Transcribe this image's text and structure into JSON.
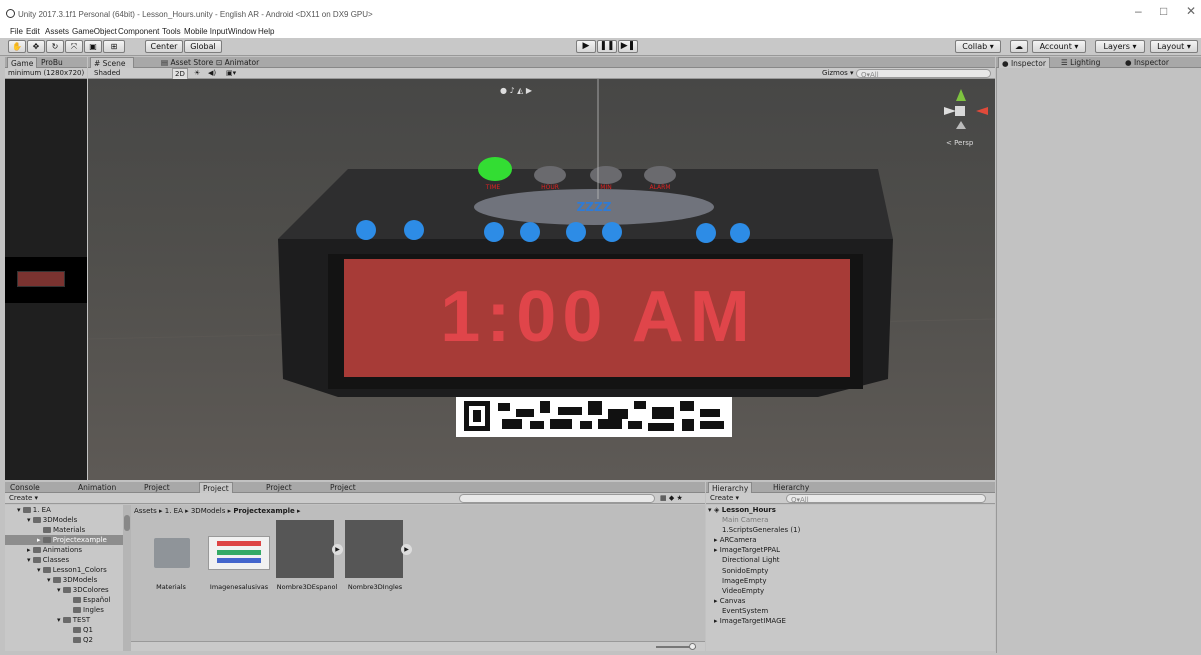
{
  "window": {
    "title": "Unity 2017.3.1f1 Personal (64bit) - Lesson_Hours.unity - English AR - Android <DX11 on DX9 GPU>",
    "controls": [
      "–",
      "□",
      "✕"
    ]
  },
  "menu": [
    "File",
    "Edit",
    "Assets",
    "GameObject",
    "Component",
    "Tools",
    "Mobile Input",
    "Window",
    "Help"
  ],
  "toolbar": {
    "center": "Center",
    "global": "Global",
    "collab": "Collab ▾",
    "account": "Account ▾",
    "layers": "Layers ▾",
    "layout": "Layout ▾"
  },
  "top_tabs": {
    "game": "Game",
    "probuilder": "ProBu",
    "scene": "# Scene",
    "asset_store": "Asset Store",
    "animator": "Animator",
    "inspector1": "Inspector",
    "lighting": "Lighting",
    "inspector2": "Inspector"
  },
  "game_view": {
    "resolution": "minimum (1280x720)"
  },
  "scene_view": {
    "shading": "Shaded",
    "mode_2d": "2D",
    "gizmos": "Gizmos ▾",
    "search": "Q▾All",
    "persp": "< Persp",
    "clock_time": "1:00 AM",
    "button_labels": [
      "TIME",
      "HOUR",
      "MIN",
      "ALARM"
    ],
    "display_small": "ZZZZ"
  },
  "bottom_tabs": [
    "Console",
    "Animation",
    "Project",
    "Project",
    "Project",
    "Project"
  ],
  "project": {
    "create": "Create ▾",
    "breadcrumb": [
      "Assets",
      "1. EA",
      "3DModels",
      "Projectexample"
    ],
    "tree": [
      {
        "label": "1. EA",
        "depth": 0
      },
      {
        "label": "3DModels",
        "depth": 1
      },
      {
        "label": "Materials",
        "depth": 2
      },
      {
        "label": "Projectexample",
        "depth": 2,
        "selected": true
      },
      {
        "label": "Animations",
        "depth": 1
      },
      {
        "label": "Classes",
        "depth": 1
      },
      {
        "label": "Lesson1_Colors",
        "depth": 2
      },
      {
        "label": "3DModels",
        "depth": 3
      },
      {
        "label": "3DColores",
        "depth": 4
      },
      {
        "label": "Español",
        "depth": 5
      },
      {
        "label": "Ingles",
        "depth": 5
      },
      {
        "label": "TEST",
        "depth": 4
      },
      {
        "label": "Q1",
        "depth": 5
      },
      {
        "label": "Q2",
        "depth": 5
      }
    ],
    "assets": [
      "Materials",
      "Imagenesalusivas",
      "Nombre3DEspanol",
      "Nombre3DIngles"
    ]
  },
  "hierarchy": {
    "tabs": [
      "Hierarchy",
      "Hierarchy"
    ],
    "create": "Create ▾",
    "search": "Q▾All",
    "scene": "Lesson_Hours",
    "items": [
      "Main Camera",
      "1.ScriptsGenerales (1)",
      "ARCamera",
      "ImageTargetPPAL",
      "Directional Light",
      "SonidoEmpty",
      "ImageEmpty",
      "VideoEmpty",
      "Canvas",
      "EventSystem",
      "ImageTargetIMAGE"
    ]
  }
}
